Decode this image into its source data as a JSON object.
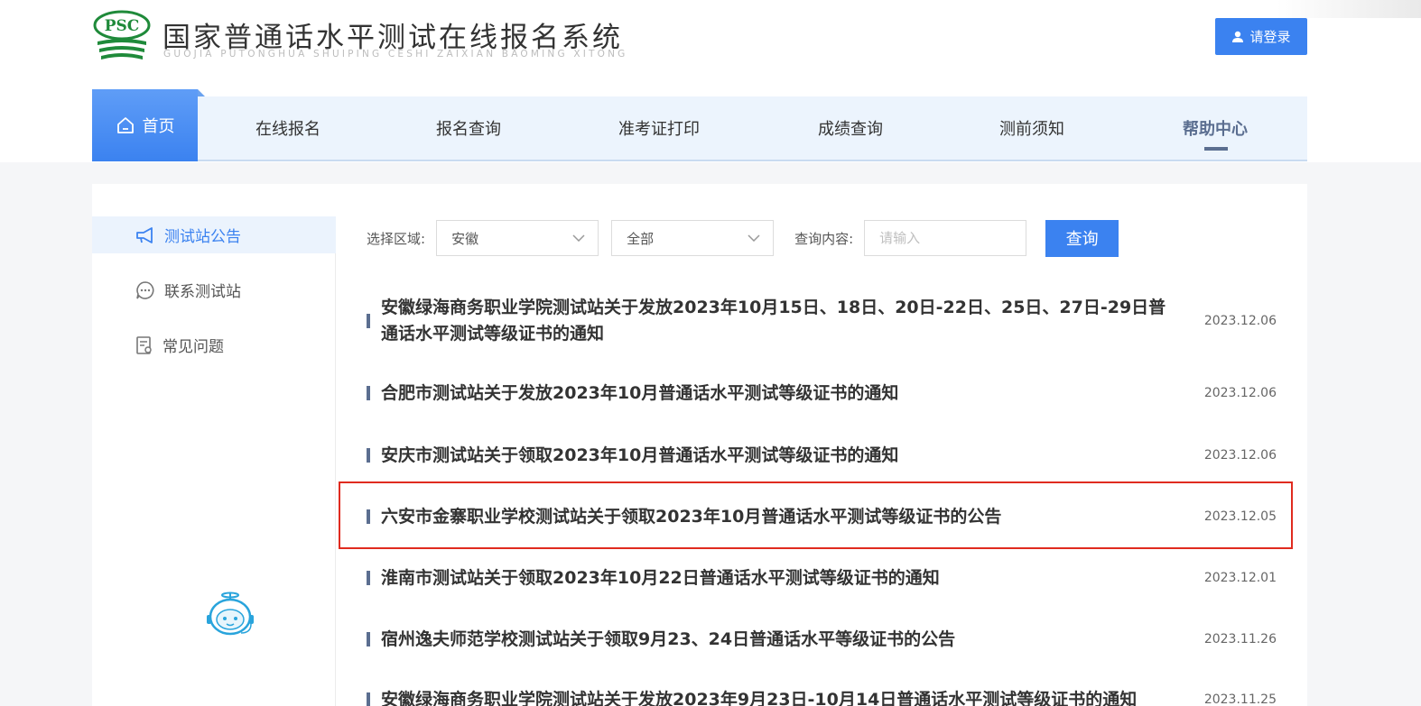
{
  "header": {
    "logo_text": "PSC",
    "title": "国家普通话水平测试在线报名系统",
    "subtitle": "GUOJIA PUTONGHUA SHUIPING CESHI ZAIXIAN BAOMING XITONG",
    "login_label": "请登录"
  },
  "nav": {
    "home": "首页",
    "items": [
      "在线报名",
      "报名查询",
      "准考证打印",
      "成绩查询",
      "测前须知",
      "帮助中心"
    ]
  },
  "sidebar": {
    "items": [
      "测试站公告",
      "联系测试站",
      "常见问题"
    ]
  },
  "filter": {
    "region_label": "选择区域:",
    "region_value": "安徽",
    "scope_value": "全部",
    "query_label": "查询内容:",
    "query_placeholder": "请输入",
    "search_label": "查询"
  },
  "notices": [
    {
      "title": "安徽绿海商务职业学院测试站关于发放2023年10月15日、18日、20日-22日、25日、27日-29日普通话水平测试等级证书的通知",
      "date": "2023.12.06"
    },
    {
      "title": "合肥市测试站关于发放2023年10月普通话水平测试等级证书的通知",
      "date": "2023.12.06"
    },
    {
      "title": "安庆市测试站关于领取2023年10月普通话水平测试等级证书的通知",
      "date": "2023.12.06"
    },
    {
      "title": "六安市金寨职业学校测试站关于领取2023年10月普通话水平测试等级证书的公告",
      "date": "2023.12.05"
    },
    {
      "title": "淮南市测试站关于领取2023年10月22日普通话水平测试等级证书的通知",
      "date": "2023.12.01"
    },
    {
      "title": "宿州逸夫师范学校测试站关于领取9月23、24日普通话水平等级证书的公告",
      "date": "2023.11.26"
    },
    {
      "title": "安徽绿海商务职业学院测试站关于发放2023年9月23日-10月14日普通话水平测试等级证书的通知",
      "date": "2023.11.25"
    }
  ],
  "colors": {
    "accent": "#3b82f0",
    "nav_bg": "#ecf4fd",
    "highlight": "#e02b1f"
  }
}
